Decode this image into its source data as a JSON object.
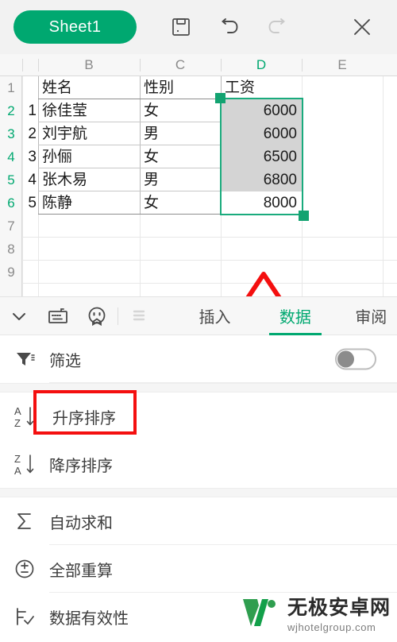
{
  "toolbar": {
    "sheet_tab_label": "Sheet1",
    "save_icon": "save-icon",
    "undo_icon": "undo-icon",
    "redo_icon": "redo-icon",
    "close_icon": "close-icon",
    "accent_color": "#00a870"
  },
  "spreadsheet": {
    "column_headers": [
      "B",
      "C",
      "D",
      "E"
    ],
    "selected_column": "D",
    "row_headers": [
      "1",
      "2",
      "3",
      "4",
      "5",
      "6",
      "7",
      "8",
      "9"
    ],
    "selected_rows": [
      "2",
      "3",
      "4",
      "5",
      "6"
    ],
    "header_row": {
      "a": "",
      "b": "姓名",
      "c": "性别",
      "d": "工资"
    },
    "rows": [
      {
        "a": "1",
        "b": "徐佳莹",
        "c": "女",
        "d": "6000"
      },
      {
        "a": "2",
        "b": "刘宇航",
        "c": "男",
        "d": "6000"
      },
      {
        "a": "3",
        "b": "孙俪",
        "c": "女",
        "d": "6500"
      },
      {
        "a": "4",
        "b": "张木易",
        "c": "男",
        "d": "6800"
      },
      {
        "a": "5",
        "b": "陈静",
        "c": "女",
        "d": "8000"
      }
    ],
    "selection_range": "D2:D6",
    "active_cell": "D2",
    "selection_color": "#1aab7d",
    "annotation_arrow": "up-arrow-annotation",
    "annotation_color": "#f40f0f"
  },
  "panel": {
    "collapse_icon": "chevron-down-icon",
    "keyboard_icon": "keyboard-icon",
    "sticker_icon": "sticker-face-icon",
    "list_icon": "list-icon-disabled",
    "tabs": [
      {
        "label": "插入",
        "active": false
      },
      {
        "label": "数据",
        "active": true
      },
      {
        "label": "审阅",
        "active": false
      }
    ],
    "menu_items": [
      {
        "label": "筛选",
        "icon": "filter-icon",
        "toggle": "off"
      },
      {
        "label": "升序排序",
        "icon": "sort-ascending-icon",
        "highlighted": true
      },
      {
        "label": "降序排序",
        "icon": "sort-descending-icon"
      },
      {
        "label": "自动求和",
        "icon": "autosum-icon"
      },
      {
        "label": "全部重算",
        "icon": "recalculate-icon"
      },
      {
        "label": "数据有效性",
        "icon": "data-validation-icon"
      }
    ]
  },
  "watermark": {
    "title": "无极安卓网",
    "url": "wjhotelgroup.com",
    "logo": "w-logo-icon"
  }
}
